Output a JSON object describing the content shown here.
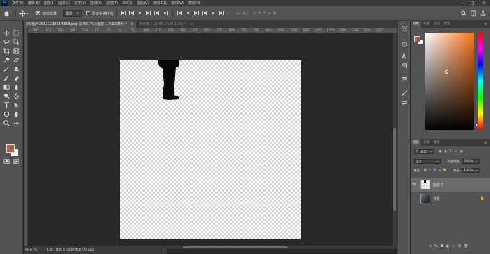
{
  "menu": {
    "logo": "Ps",
    "items": [
      "文件(F)",
      "编辑(E)",
      "图像(I)",
      "图层(L)",
      "文字(Y)",
      "选择(S)",
      "滤镜(T)",
      "3D(D)",
      "视图(V)",
      "增效工具",
      "窗口(W)",
      "帮助(H)"
    ],
    "window_controls": [
      "—",
      "□",
      "✕"
    ]
  },
  "options": {
    "auto_select_label": "自动选择:",
    "auto_select_value": "图层",
    "show_transform_label": "显示变换控件",
    "mode_3d_label": "3D 模式:"
  },
  "tabs": [
    {
      "label": "QQ图片20221218154358.png @ 66.7% (图层 1, RGB/8#) *",
      "close": "×"
    },
    {
      "label": "未标题-1 @ 45.1%(RGB/8) *",
      "close": "×"
    }
  ],
  "ruler": {
    "ticks": [
      "504",
      "433",
      "360",
      "288",
      "216",
      "144",
      "72",
      "0",
      "72",
      "144",
      "216",
      "288",
      "360",
      "432",
      "504",
      "576",
      "648",
      "720",
      "792",
      "864",
      "936",
      "1008",
      "1080",
      "1152",
      "1224",
      "1296",
      "1368",
      "1440",
      "1512"
    ]
  },
  "status": {
    "zoom": "66.67%",
    "doc_size": "1047 像素 x 1039 像素 (72 ppi)"
  },
  "color_panel": {
    "tabs": [
      "颜色",
      "色板",
      "渐变",
      "图案"
    ],
    "fg_color": "#a4624a",
    "bg_color": "#ffffff",
    "hue_base": "#ff7418"
  },
  "layers_panel": {
    "tabs": [
      "图层",
      "通道",
      "路径"
    ],
    "filter_label": "类型",
    "blend_mode": "正常",
    "opacity_label": "不透明度:",
    "opacity_value": "100%",
    "lock_label": "锁定:",
    "fill_label": "填充:",
    "fill_value": "100%",
    "layers": [
      {
        "name": "图层 1",
        "selected": true,
        "visible": true
      },
      {
        "name": "背景",
        "selected": false,
        "visible": false,
        "locked": true
      }
    ],
    "bottom_icons": [
      "fx"
    ]
  }
}
